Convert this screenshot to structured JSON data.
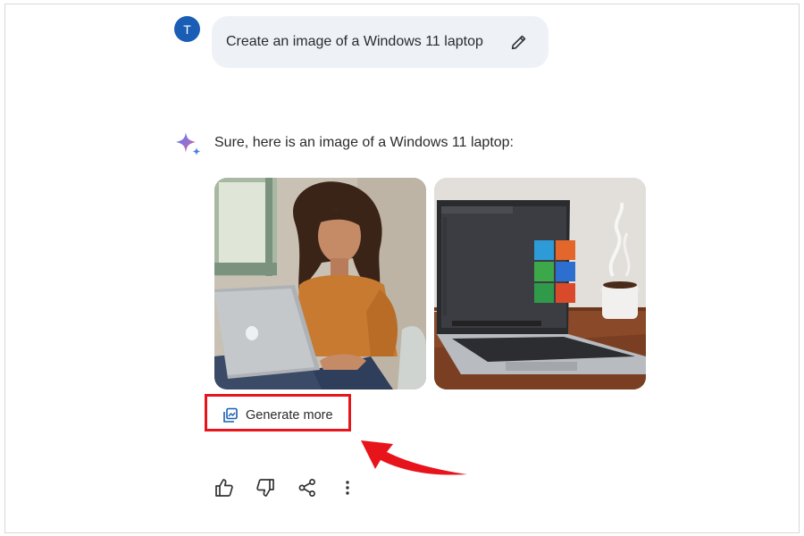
{
  "user_message": {
    "avatar_initial": "T",
    "prompt": "Create an image of a Windows 11 laptop",
    "edit_icon": "pencil-icon"
  },
  "assistant_message": {
    "icon": "sparkle-icon",
    "reply": "Sure, here is an image of a Windows 11 laptop:",
    "images": [
      {
        "subject": "woman-with-laptop"
      },
      {
        "subject": "windows-laptop-with-coffee"
      }
    ],
    "generate_more": {
      "label": "Generate more",
      "icon": "image-stack-icon"
    }
  },
  "actions": [
    {
      "name": "thumbs-up-icon"
    },
    {
      "name": "thumbs-down-icon"
    },
    {
      "name": "share-icon"
    },
    {
      "name": "more-vert-icon"
    }
  ],
  "colors": {
    "avatar": "#1a5db4",
    "bubble": "#eef2f7",
    "highlight": "#e8141b",
    "sparkle_blue": "#4a7ee3",
    "sparkle_red": "#e05b4a"
  }
}
